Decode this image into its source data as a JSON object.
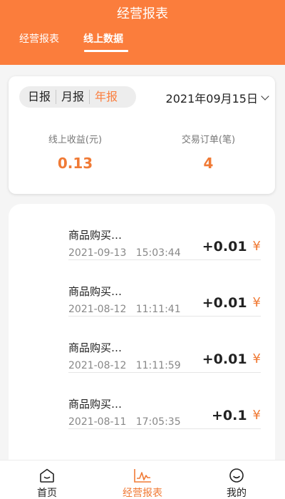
{
  "header": {
    "title": "经营报表",
    "tabs": [
      {
        "label": "经营报表"
      },
      {
        "label": "线上数据"
      }
    ]
  },
  "summary": {
    "periods": [
      "日报",
      "月报",
      "年报"
    ],
    "selected_period": "年报",
    "date": "2021年09月15日",
    "online_income_label": "线上收益(元)",
    "online_income_value": "0.13",
    "orders_label": "交易订单(笔)",
    "orders_value": "4"
  },
  "transactions": [
    {
      "title": "商品购买…",
      "date": "2021-09-13",
      "time": "15:03:44",
      "amount": "+0.01",
      "currency": "¥"
    },
    {
      "title": "商品购买…",
      "date": "2021-08-12",
      "time": "11:11:41",
      "amount": "+0.01",
      "currency": "¥"
    },
    {
      "title": "商品购买…",
      "date": "2021-08-12",
      "time": "11:11:59",
      "amount": "+0.01",
      "currency": "¥"
    },
    {
      "title": "商品购买…",
      "date": "2021-08-11",
      "time": "17:05:35",
      "amount": "+0.1",
      "currency": "¥"
    }
  ],
  "bottom_nav": [
    {
      "label": "首页",
      "icon": "home-icon"
    },
    {
      "label": "经营报表",
      "icon": "chart-icon"
    },
    {
      "label": "我的",
      "icon": "profile-icon"
    }
  ],
  "colors": {
    "accent": "#fb7d3c",
    "accent_text": "#f07a35"
  }
}
